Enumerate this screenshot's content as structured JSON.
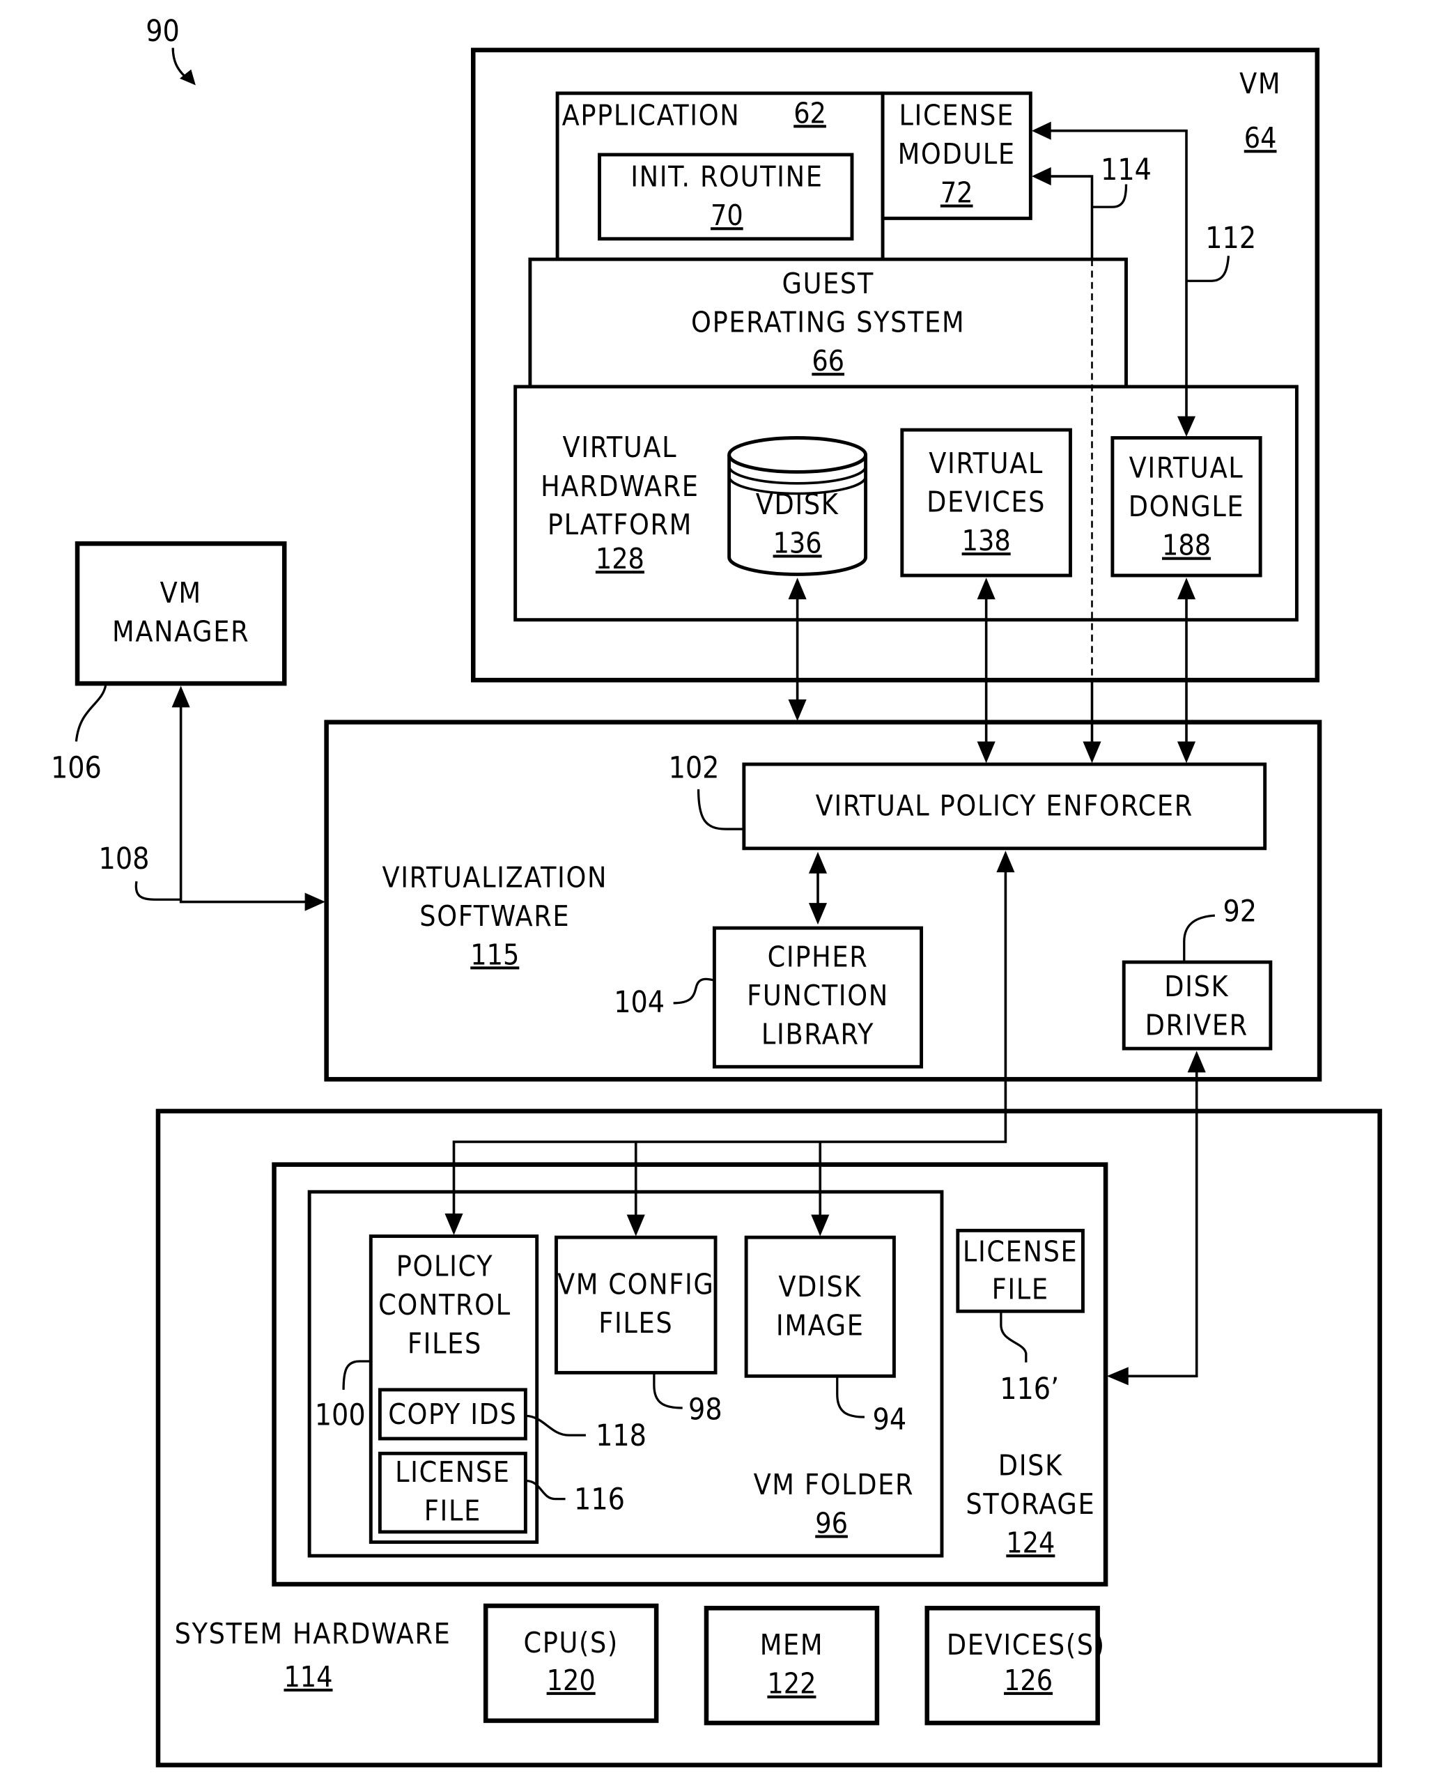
{
  "figure": {
    "ref": "90",
    "vm": {
      "label": "VM",
      "number": "64",
      "application": {
        "label": "APPLICATION",
        "number": "62"
      },
      "init_routine": {
        "lines": [
          "INIT. ROUTINE"
        ],
        "number": "70"
      },
      "license_module": {
        "lines": [
          "LICENSE",
          "MODULE"
        ],
        "number": "72"
      },
      "guest_os": {
        "lines": [
          "GUEST",
          "OPERATING SYSTEM"
        ],
        "number": "66"
      },
      "virtual_hardware_platform": {
        "lines": [
          "VIRTUAL",
          "HARDWARE",
          "PLATFORM"
        ],
        "number": "128"
      },
      "vdisk": {
        "lines": [
          "VDISK"
        ],
        "number": "136"
      },
      "virtual_devices": {
        "lines": [
          "VIRTUAL",
          "DEVICES"
        ],
        "number": "138"
      },
      "virtual_dongle": {
        "lines": [
          "VIRTUAL",
          "DONGLE"
        ],
        "number": "188"
      },
      "ref_114": "114",
      "ref_112": "112"
    },
    "vm_manager": {
      "lines": [
        "VM",
        "MANAGER"
      ],
      "ref": "106",
      "link_ref": "108"
    },
    "virtualization_software": {
      "lines": [
        "VIRTUALIZATION",
        "SOFTWARE"
      ],
      "number": "115",
      "policy_enforcer": {
        "label": "VIRTUAL POLICY ENFORCER",
        "ref": "102"
      },
      "cipher_library": {
        "lines": [
          "CIPHER",
          "FUNCTION",
          "LIBRARY"
        ],
        "ref": "104"
      },
      "disk_driver": {
        "lines": [
          "DISK",
          "DRIVER"
        ],
        "ref": "92"
      }
    },
    "system_hardware": {
      "lines": [
        "SYSTEM HARDWARE"
      ],
      "number": "114",
      "disk_storage": {
        "lines": [
          "DISK",
          "STORAGE"
        ],
        "number": "124",
        "license_file": {
          "lines": [
            "LICENSE",
            "FILE"
          ],
          "ref": "116’"
        },
        "vm_folder": {
          "label": "VM FOLDER",
          "number": "96",
          "policy_control_files": {
            "lines": [
              "POLICY",
              "CONTROL",
              "FILES"
            ],
            "ref": "100"
          },
          "copy_ids": {
            "label": "COPY IDS",
            "ref": "118"
          },
          "license_file": {
            "lines": [
              "LICENSE",
              "FILE"
            ],
            "ref": "116"
          },
          "vm_config_files": {
            "lines": [
              "VM CONFIG",
              "FILES"
            ],
            "ref": "98"
          },
          "vdisk_image": {
            "lines": [
              "VDISK",
              "IMAGE"
            ],
            "ref": "94"
          }
        }
      },
      "cpu": {
        "label": "CPU(S)",
        "number": "120"
      },
      "mem": {
        "label": "MEM",
        "number": "122"
      },
      "devices": {
        "label": "DEVICES(S)",
        "number": "126"
      }
    }
  }
}
